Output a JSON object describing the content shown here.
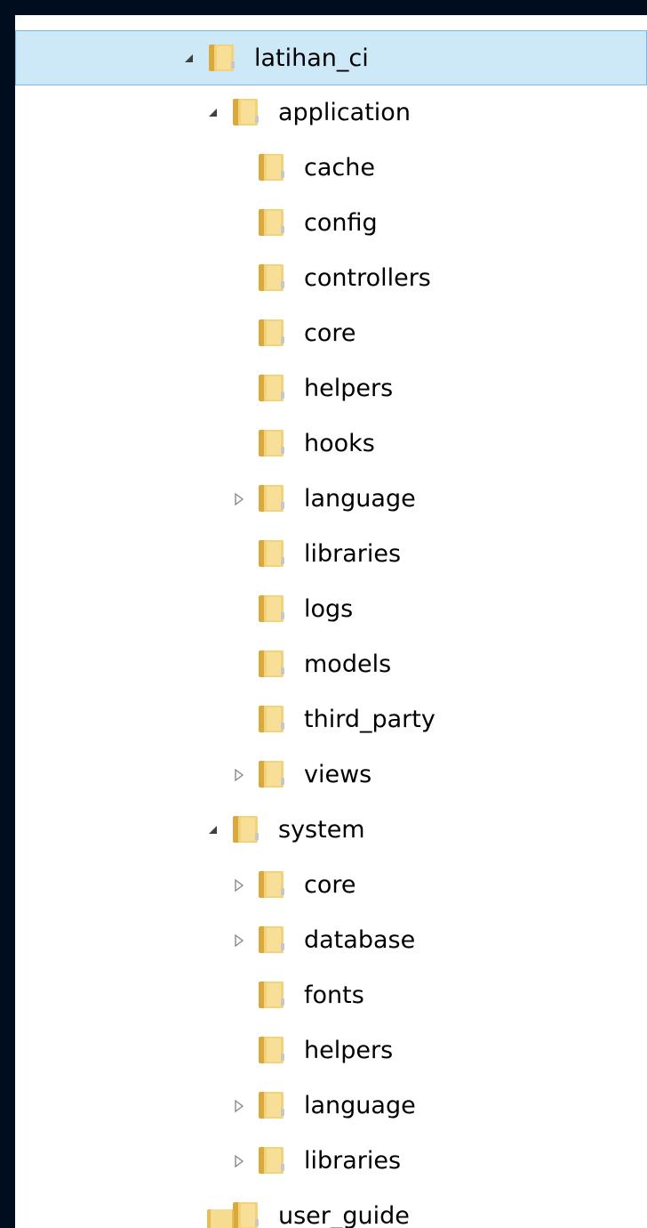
{
  "tree": {
    "items": [
      {
        "label": "latihan_ci",
        "level": 0,
        "expander": "expanded",
        "selected": true
      },
      {
        "label": "application",
        "level": 1,
        "expander": "expanded"
      },
      {
        "label": "cache",
        "level": 2,
        "expander": "none"
      },
      {
        "label": "config",
        "level": 2,
        "expander": "none"
      },
      {
        "label": "controllers",
        "level": 2,
        "expander": "none"
      },
      {
        "label": "core",
        "level": 2,
        "expander": "none"
      },
      {
        "label": "helpers",
        "level": 2,
        "expander": "none"
      },
      {
        "label": "hooks",
        "level": 2,
        "expander": "none"
      },
      {
        "label": "language",
        "level": 2,
        "expander": "collapsed"
      },
      {
        "label": "libraries",
        "level": 2,
        "expander": "none"
      },
      {
        "label": "logs",
        "level": 2,
        "expander": "none"
      },
      {
        "label": "models",
        "level": 2,
        "expander": "none"
      },
      {
        "label": "third_party",
        "level": 2,
        "expander": "none"
      },
      {
        "label": "views",
        "level": 2,
        "expander": "collapsed"
      },
      {
        "label": "system",
        "level": 1,
        "expander": "expanded"
      },
      {
        "label": "core",
        "level": 2,
        "expander": "collapsed"
      },
      {
        "label": "database",
        "level": 2,
        "expander": "collapsed"
      },
      {
        "label": "fonts",
        "level": 2,
        "expander": "none"
      },
      {
        "label": "helpers",
        "level": 2,
        "expander": "none"
      },
      {
        "label": "language",
        "level": 2,
        "expander": "collapsed"
      },
      {
        "label": "libraries",
        "level": 2,
        "expander": "collapsed"
      },
      {
        "label": "user_guide",
        "level": 1,
        "expander": "collapsed"
      }
    ]
  },
  "colors": {
    "background": "#000d1e",
    "panel": "#ffffff",
    "selection_fill": "#cde8f7",
    "selection_border": "#7fb8de",
    "folder_main": "#f3d27a",
    "folder_dark": "#d9a93e",
    "folder_light": "#fbe9b0"
  },
  "icons": {
    "folder": "folder-icon",
    "expanded": "expanded-triangle-icon",
    "collapsed": "collapsed-triangle-icon"
  }
}
